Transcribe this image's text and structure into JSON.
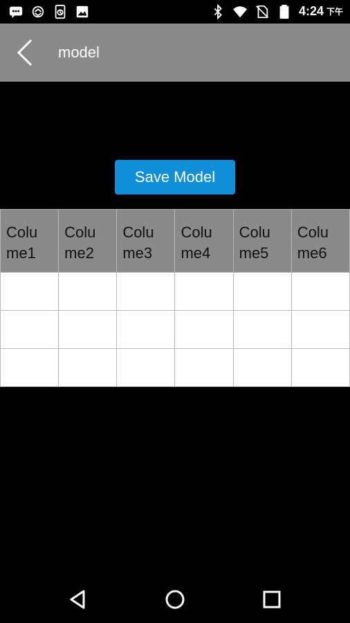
{
  "status_bar": {
    "left_icons": [
      "message-icon",
      "sync-icon",
      "phone-update-icon",
      "image-icon"
    ],
    "right_icons": [
      "bluetooth-icon",
      "wifi-icon",
      "no-sim-icon",
      "battery-icon"
    ],
    "time": "4:24",
    "ampm": "下午"
  },
  "app_bar": {
    "back_icon": "chevron-left-icon",
    "title": "model"
  },
  "save_button": {
    "label": "Save Model",
    "color": "#0f8fd8"
  },
  "table": {
    "header_color": "#8a8a8a",
    "columns": [
      "Colu\nme1",
      "Colu\nme2",
      "Colu\nme3",
      "Colu\nme4",
      "Colu\nme5",
      "Colu\nme6"
    ],
    "rows": [
      [
        "",
        "",
        "",
        "",
        "",
        ""
      ],
      [
        "",
        "",
        "",
        "",
        "",
        ""
      ],
      [
        "",
        "",
        "",
        "",
        "",
        ""
      ]
    ]
  },
  "nav_bar": {
    "buttons": [
      "back-triangle-icon",
      "home-circle-icon",
      "recents-square-icon"
    ]
  }
}
